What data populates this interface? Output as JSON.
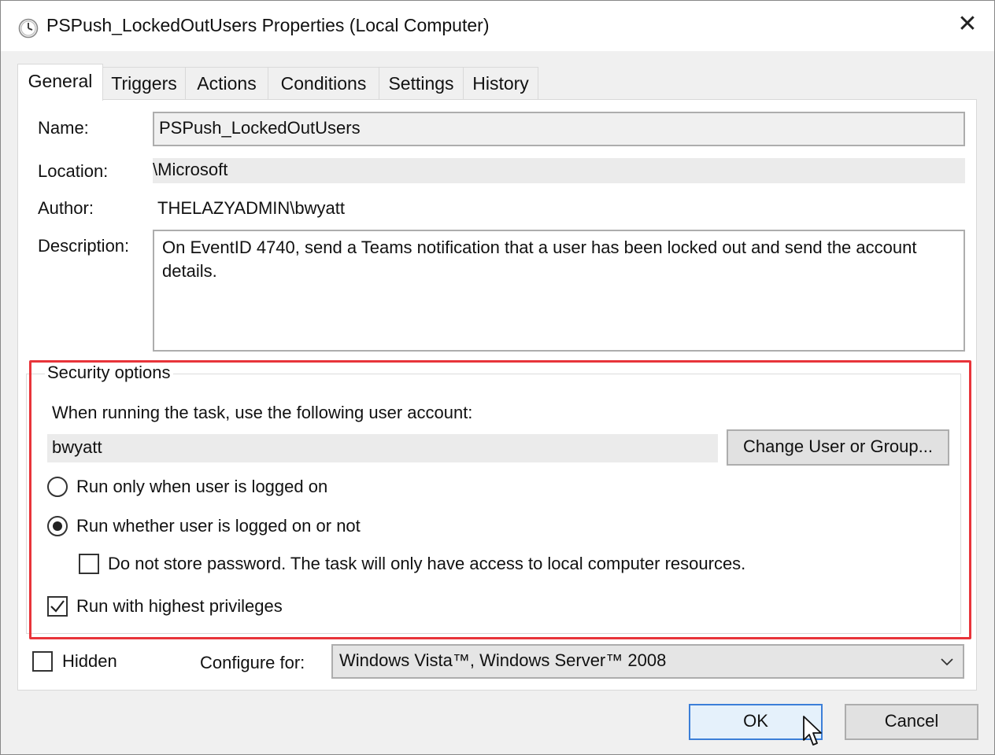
{
  "window": {
    "title": "PSPush_LockedOutUsers Properties (Local Computer)",
    "close_glyph": "✕"
  },
  "tabs": [
    {
      "label": "General",
      "active": true
    },
    {
      "label": "Triggers"
    },
    {
      "label": "Actions"
    },
    {
      "label": "Conditions"
    },
    {
      "label": "Settings"
    },
    {
      "label": "History"
    }
  ],
  "general": {
    "name_label": "Name:",
    "name_value": "PSPush_LockedOutUsers",
    "location_label": "Location:",
    "location_value": "\\Microsoft",
    "author_label": "Author:",
    "author_value": "THELAZYADMIN\\bwyatt",
    "description_label": "Description:",
    "description_value": "On EventID 4740, send a Teams notification that a user has been locked out and send the account details."
  },
  "security": {
    "legend": "Security options",
    "account_prompt": "When running the task, use the following user account:",
    "account_value": "bwyatt",
    "change_user_button": "Change User or Group...",
    "radio_logged_on": "Run only when user is logged on",
    "radio_whether": "Run whether user is logged on or not",
    "selected_radio": "whether",
    "no_store_password": "Do not store password.  The task will only have access to local computer resources.",
    "no_store_password_checked": false,
    "highest_privileges": "Run with highest privileges",
    "highest_privileges_checked": true,
    "highlight_color": "#e8343a"
  },
  "footer": {
    "hidden_label": "Hidden",
    "hidden_checked": false,
    "configure_label": "Configure for:",
    "configure_value": "Windows Vista™, Windows Server™ 2008",
    "ok_button": "OK",
    "cancel_button": "Cancel"
  },
  "icons": {
    "title_icon": "clock-icon",
    "close_icon": "close-icon",
    "dropdown_icon": "chevron-down-icon",
    "cursor": "mouse-pointer-icon"
  },
  "colors": {
    "ok_border": "#3c7fd8",
    "ok_background": "#e5f1fb"
  }
}
